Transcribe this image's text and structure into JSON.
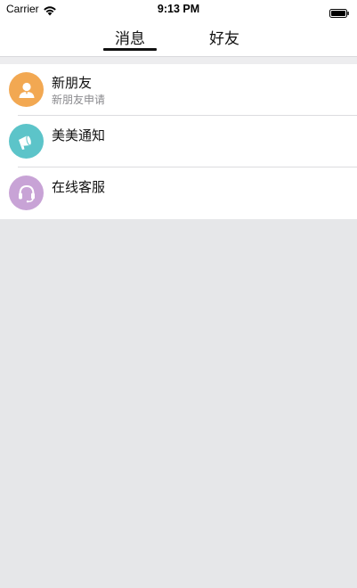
{
  "status_bar": {
    "carrier": "Carrier",
    "time": "9:13 PM",
    "icons": [
      "wifi-icon",
      "battery-icon"
    ]
  },
  "tabs": [
    {
      "label": "消息",
      "selected": true
    },
    {
      "label": "好友",
      "selected": false
    }
  ],
  "list": {
    "items": [
      {
        "title": "新朋友",
        "subtitle": "新朋友申请",
        "icon": "person-icon",
        "color": "#f2a852"
      },
      {
        "title": "美美通知",
        "subtitle": "",
        "icon": "megaphone-icon",
        "color": "#5cc4c9"
      },
      {
        "title": "在线客服",
        "subtitle": "",
        "icon": "headset-icon",
        "color": "#c8a3d6"
      }
    ]
  },
  "colors": {
    "background": "#e6e7e9",
    "surface": "#ffffff",
    "tab_indicator": "#111111"
  }
}
